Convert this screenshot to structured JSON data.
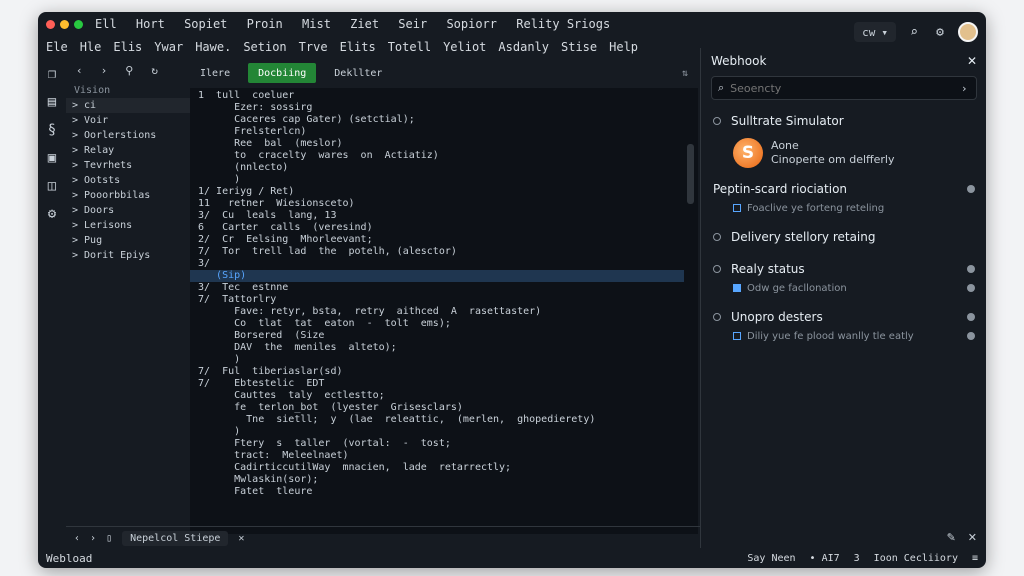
{
  "title_menu": [
    "Ell",
    "Hort",
    "Sopiet",
    "Proin",
    "Mist",
    "Ziet",
    "Seir",
    "Sopiorr",
    "Relity Sriogs"
  ],
  "menu": [
    "Ele",
    "Hle",
    "Elis",
    "Ywar",
    "Hawe.",
    "Setion",
    "Trve",
    "Elits",
    "Totell",
    "Yeliot",
    "Asdanly",
    "Stise",
    "Help"
  ],
  "topright": {
    "select_value": "cw"
  },
  "explorer": {
    "title": "Vision",
    "items": [
      "> ci",
      "> Voir",
      "> Oorlerstions",
      "> Relay",
      "> Tevrhets",
      "> Ootsts",
      "> Pooorbbilas",
      "> Doors",
      "> Lerisons",
      "> Pug",
      "> Dorit Epiys"
    ]
  },
  "editor": {
    "tabs": [
      "Ilere",
      "Docbiing",
      "Dekllter"
    ],
    "lines": [
      "1  tull  coeluer",
      "      Ezer: sossirg",
      "      Caceres cap Gater) (setctial);",
      "      Frelsterlcn)",
      "      Ree  bal  (meslor)",
      "      to  cracelty  wares  on  Actiatiz)",
      "      (nnlecto)",
      "      )",
      "1/ Ieriyg / Ret)",
      "11   retner  Wiesionsceto)",
      "3/  Cu  leals  lang, 13",
      "6   Carter  calls  (veresind)",
      "2/  Cr  Eelsing  Mhorleevant;",
      "7/  Tor  trell lad  the  potelh, (alesctor)",
      "3/",
      "",
      "",
      "   (Sip)",
      "3/  Tec  estnne",
      "7/  Tattorlry",
      "      Fave: retyr, bsta,  retry  aithced  A  rasettaster)",
      "      Co  tlat  tat  eaton  -  tolt  ems);",
      "      Borsered  (Size",
      "      DAV  the  meniles  alteto);",
      "      )",
      "7/  Ful  tiberiaslar(sd)",
      "7/    Ebtestelic  EDT",
      "      Cauttes  taly  ectlestto;",
      "      fe  terlon_bot  (lyester  Grisesclars)",
      "        Tne  sietll;  y  (lae  releattic,  (merlen,  ghopedierety)",
      "      )",
      "      Ftery  s  taller  (vortal:  -  tost;",
      "      tract:  Meleelnaet)",
      "      CadirticcutilWay  mnacien,  lade  retarrectly;",
      "      Mwlaskin(sor);",
      "",
      "      Fatet  tleure"
    ]
  },
  "bottom": {
    "tab": "Nepelcol Stiepe"
  },
  "status": {
    "left": "Webload",
    "right": [
      "Say  Neen",
      "• AI7",
      "3",
      "Ioon  Cecliiory",
      "≡"
    ]
  },
  "panel": {
    "title": "Webhook",
    "search_placeholder": "Seoencty",
    "sections": [
      {
        "label": "Sulltrate Simulator"
      },
      {
        "label": "Peptin-scard riociation",
        "sub": [
          "Foaclive  ye  forteng  reteling"
        ]
      },
      {
        "label": "Delivery stellory retaing"
      },
      {
        "label": "Realy status",
        "sub": [
          "Odw  ge  facllonation"
        ]
      },
      {
        "label": "Unopro desters",
        "sub": [
          "Diliy  yue  fe  plood  wanlly  tle  eatly"
        ]
      }
    ],
    "user": {
      "name": "Aone",
      "status": "Cinoperte  om  delfferly",
      "initial": "S"
    }
  },
  "colors": {
    "window": "#161b22",
    "editor": "#0d1117",
    "accent_green": "#238636",
    "accent_blue": "#58a6ff",
    "avatar_orange": "#e86410"
  }
}
